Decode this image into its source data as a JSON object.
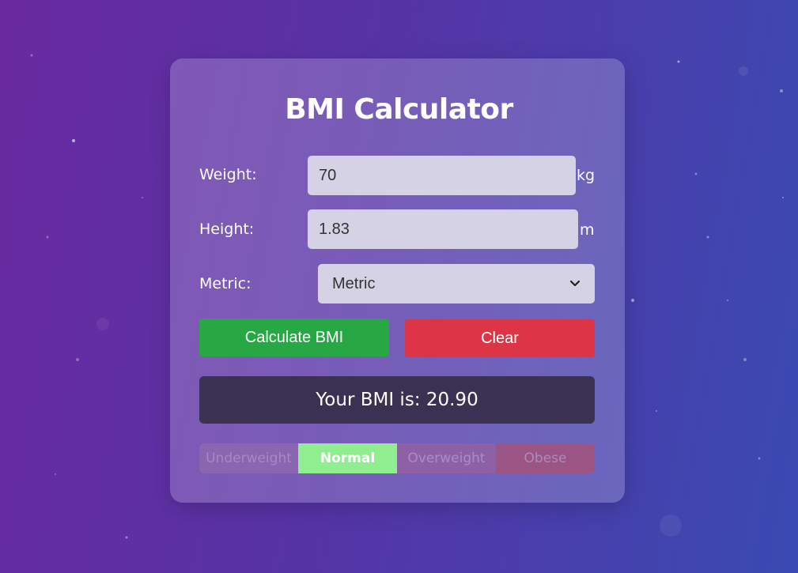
{
  "app": {
    "title": "BMI Calculator"
  },
  "form": {
    "weight": {
      "label": "Weight:",
      "value": "70",
      "unit": "kg"
    },
    "height": {
      "label": "Height:",
      "value": "1.83",
      "unit": "m"
    },
    "system": {
      "label": "Metric:",
      "selected": "Metric"
    }
  },
  "buttons": {
    "calculate": "Calculate BMI",
    "clear": "Clear"
  },
  "result": {
    "text": "Your BMI is: 20.90"
  },
  "scale": {
    "categories": [
      "Underweight",
      "Normal",
      "Overweight",
      "Obese"
    ],
    "active": "Normal"
  },
  "colors": {
    "calculate": "#28a745",
    "clear": "#dc3545",
    "active_category": "#90ee90",
    "result_bg": "#3b3152"
  }
}
